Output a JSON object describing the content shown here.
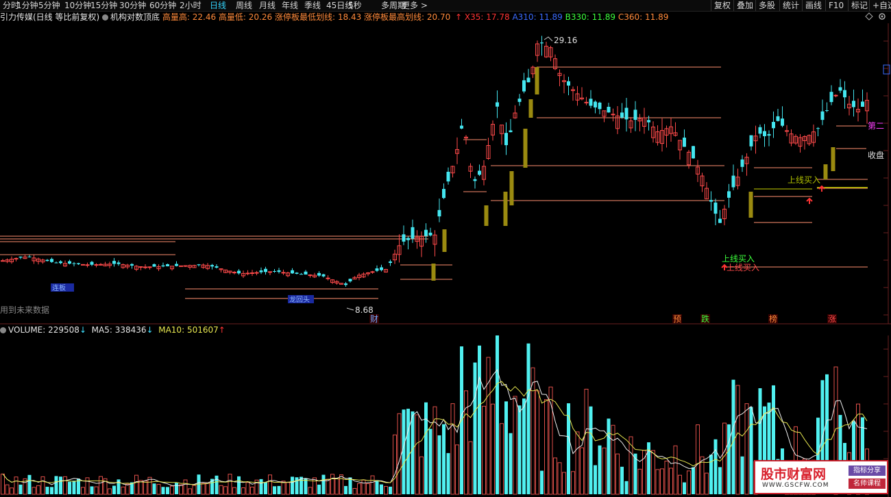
{
  "toolbar": {
    "timeframes": [
      "分时",
      "1分钟",
      "5分钟",
      "10分钟",
      "15分钟",
      "30分钟",
      "60分钟",
      "2小时",
      "日线",
      "周线",
      "月线",
      "年线",
      "季线",
      "45日线",
      "5秒",
      "多周期",
      "更多 >"
    ],
    "active": "日线",
    "right_tools": [
      "复权",
      "叠加",
      "多股",
      "统计",
      "画线",
      "F10",
      "标记",
      "+自选"
    ]
  },
  "info": {
    "stock": "引力传媒(日线 等比前复权)",
    "indicator": "机构对数顶底",
    "hh_label": "高量高:",
    "hh_val": "22.46",
    "hl_label": "高量低:",
    "hl_val": "20.26",
    "zl_label": "涨停板最低划线:",
    "zl_val": "18.43",
    "zh_label": "涨停板最高划线:",
    "zh_val": "20.70",
    "x35_label": "X35:",
    "x35_val": "17.78",
    "a310_label": "A310:",
    "a310_val": "11.89",
    "b330_label": "B330:",
    "b330_val": "11.89",
    "c360_label": "C360:",
    "c360_val": "11.89"
  },
  "volume": {
    "label": "VOLUME:",
    "value": "229508",
    "value_arrow": "↓",
    "ma5_label": "MA5:",
    "ma5": "338436",
    "ma5_arrow": "↓",
    "ma10_label": "MA10:",
    "ma10": "501607",
    "ma10_arrow": "↑"
  },
  "annotations": {
    "high": "29.16",
    "low": "8.68",
    "future_data": "用到未来数据",
    "cai": "财",
    "yu": "预",
    "die": "跌",
    "bang": "榜",
    "zhang": "涨",
    "buy1": "上线买入",
    "buy2": "上线买入",
    "buy3": "上线买入",
    "second": "第二",
    "close": "收盘",
    "blue_tag1": "连板",
    "blue_tag2": "龙回头"
  },
  "watermark": {
    "site": "股市财富网",
    "url": "WWW.GSCFW.COM",
    "box1": "指标分享",
    "box2": "名师课程"
  },
  "colors": {
    "up": "#ff4a4a",
    "down": "#44e6f0",
    "line": "#ff9070",
    "volUp": "#e0504a",
    "volDown": "#50f0f0"
  }
}
